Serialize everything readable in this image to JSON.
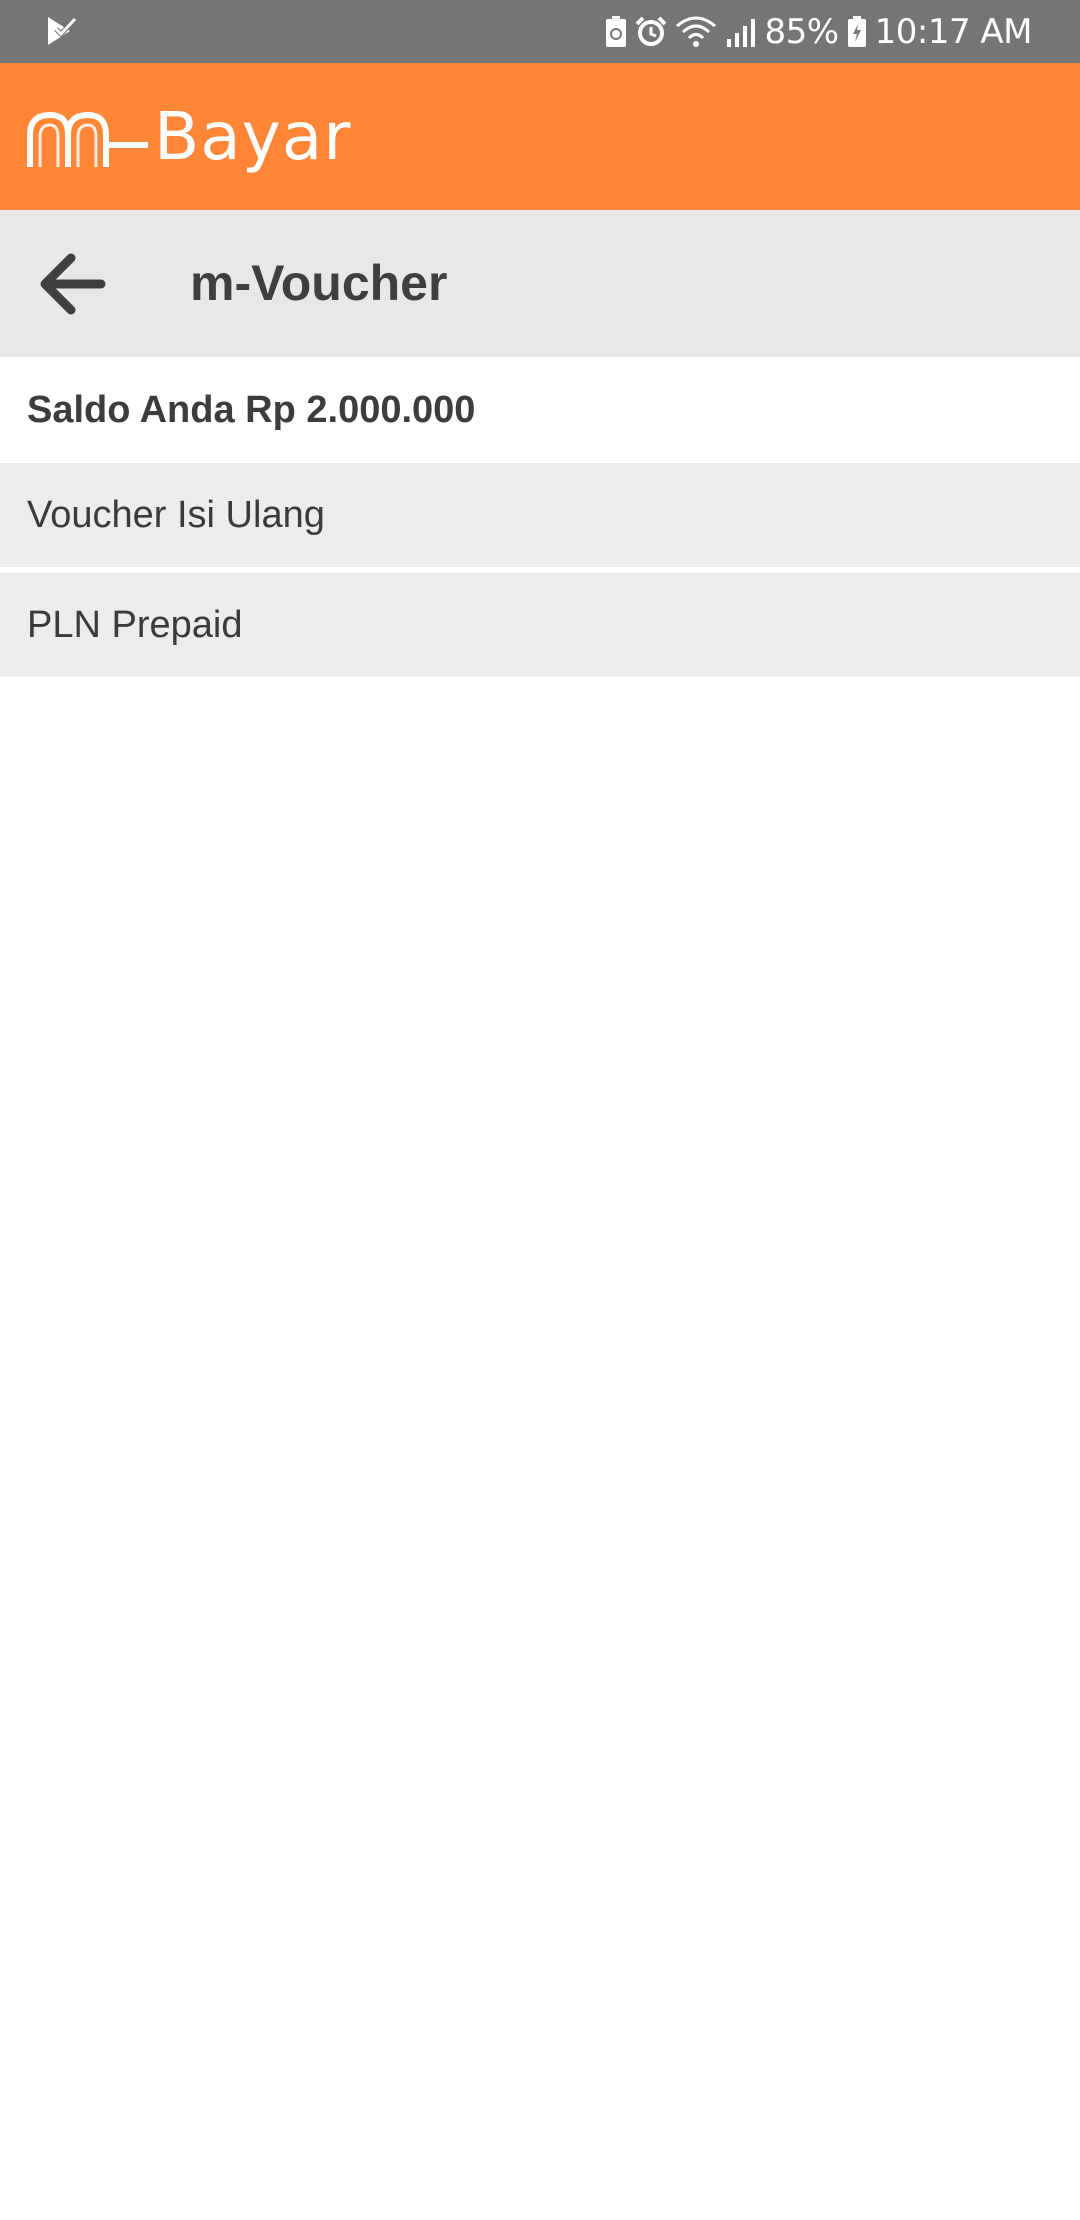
{
  "status_bar": {
    "battery_percent": "85%",
    "time": "10:17 AM",
    "icons": [
      "notification-icon",
      "battery-saver-icon",
      "alarm-icon",
      "wifi-icon",
      "signal-icon",
      "battery-charging-icon"
    ]
  },
  "header": {
    "logo_text": "Bayar",
    "brand_color": "#ff8637"
  },
  "toolbar": {
    "back_icon": "arrow-left-icon",
    "title": "m-Voucher"
  },
  "balance": {
    "text": "Saldo Anda Rp 2.000.000"
  },
  "menu": {
    "items": [
      {
        "label": "Voucher Isi Ulang"
      },
      {
        "label": "PLN Prepaid"
      }
    ]
  }
}
